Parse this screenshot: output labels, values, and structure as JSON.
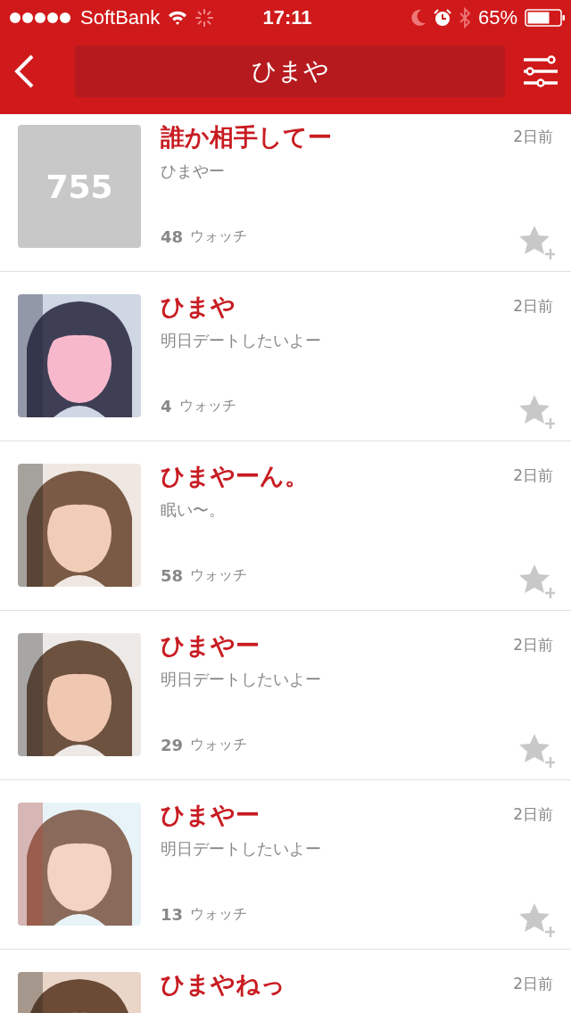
{
  "status_bar": {
    "carrier": "SoftBank",
    "time": "17:11",
    "battery": "65%"
  },
  "nav": {
    "title": "ひまや"
  },
  "posts": [
    {
      "title": "誰か相手してー",
      "subtitle": "ひまやー",
      "date": "2日前",
      "watch_count": "48",
      "watch_label": "ウォッチ",
      "thumb": {
        "kind": "placeholder",
        "logo": "755"
      }
    },
    {
      "title": "ひまや",
      "subtitle": "明日デートしたいよー",
      "date": "2日前",
      "watch_count": "4",
      "watch_label": "ウォッチ"
    },
    {
      "title": "ひまやーん。",
      "subtitle": "眠い〜。",
      "date": "2日前",
      "watch_count": "58",
      "watch_label": "ウォッチ"
    },
    {
      "title": "ひまやー",
      "subtitle": "明日デートしたいよー",
      "date": "2日前",
      "watch_count": "29",
      "watch_label": "ウォッチ"
    },
    {
      "title": "ひまやー",
      "subtitle": "明日デートしたいよー",
      "date": "2日前",
      "watch_count": "13",
      "watch_label": "ウォッチ"
    },
    {
      "title": "ひまやねっ",
      "date": "2日前"
    }
  ]
}
